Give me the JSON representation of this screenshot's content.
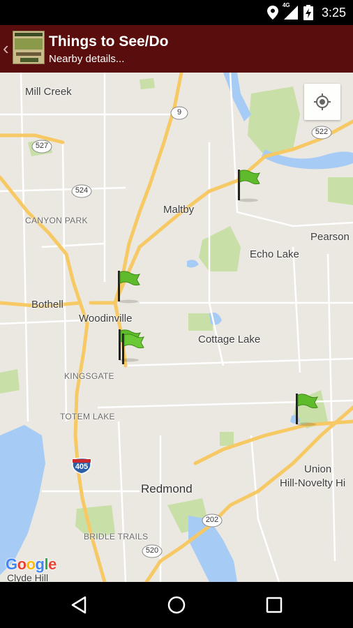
{
  "status_bar": {
    "network": "4G",
    "time": "3:25",
    "icons": [
      "location-icon",
      "signal-icon",
      "battery-charging-icon"
    ]
  },
  "app_bar": {
    "back_icon": "chevron-left-icon",
    "logo_icon": "woodinville-wine-country-logo",
    "title": "Things to See/Do",
    "subtitle": "Nearby details..."
  },
  "map": {
    "places": {
      "mill_creek": "Mill Creek",
      "canyon_park": "CANYON PARK",
      "maltby": "Maltby",
      "pearson": "Pearson",
      "echo_lake": "Echo Lake",
      "bothell": "Bothell",
      "woodinville": "Woodinville",
      "cottage_lake": "Cottage Lake",
      "kingsgate": "KINGSGATE",
      "totem_lake": "TOTEM LAKE",
      "union_hill_1": "Union",
      "union_hill_2": "Hill-Novelty Hi",
      "redmond": "Redmond",
      "bridle_trails": "BRIDLE TRAILS",
      "clyde_hill": "Clyde Hill"
    },
    "road_shields": {
      "sr9": "9",
      "sr527": "527",
      "sr524": "524",
      "sr522": "522",
      "i405": "405",
      "sr202": "202",
      "sr520": "520"
    },
    "locate_icon": "my-location-icon",
    "marker_icon": "green-flag-icon",
    "attribution": [
      "G",
      "o",
      "o",
      "g",
      "l",
      "e"
    ],
    "colors": {
      "land": "#ebe8e1",
      "park": "#c8dfa8",
      "water": "#a6cbf4",
      "highway": "#f6c965",
      "road": "#ffffff",
      "app_bar": "#5a0d0d",
      "flag": "#5fba2c"
    }
  },
  "nav_bar": {
    "back_icon": "nav-back-icon",
    "home_icon": "nav-home-icon",
    "recents_icon": "nav-recents-icon"
  }
}
